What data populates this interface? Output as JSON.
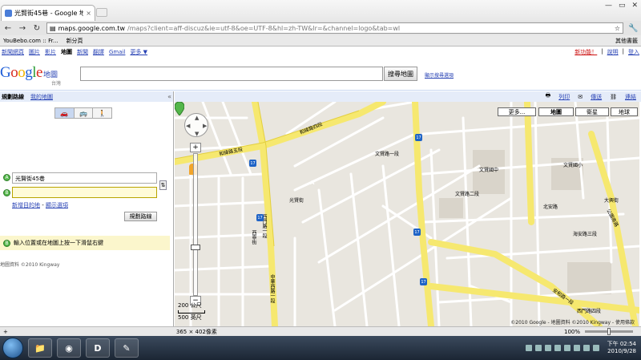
{
  "browser": {
    "tab_title": "光賢街45巷 - Google 地圖",
    "tab_close": "×",
    "url_domain": "maps.google.com.tw",
    "url_rest": "/maps?client=aff-discuz&ie=utf-8&oe=UTF-8&hl=zh-TW&lr=&channel=logo&tab=wl",
    "bookmarks": [
      "YouBebo.com :: Fr...",
      "新分頁"
    ],
    "other_bookmarks": "其他書籤"
  },
  "gbar": {
    "links": [
      "新聞網頁",
      "圖片",
      "影片",
      "地圖",
      "新聞",
      "翻譯",
      "Gmail",
      "更多 ▼"
    ],
    "current": "地圖",
    "new_feature": "新功能！",
    "help": "說明",
    "login": "登入"
  },
  "header": {
    "logo": "Google",
    "logo_suffix": "地圖",
    "region": "台灣",
    "search_value": "",
    "search_button": "搜尋地圖",
    "search_options": "顯示搜尋選項"
  },
  "panel": {
    "tab_directions": "規劃路線",
    "tab_mymaps": "我的地圖",
    "collapse": "«",
    "modes": [
      "🚗",
      "🚌",
      "🚶"
    ],
    "pin_a": "A",
    "pin_b": "B",
    "field_a": "光賢街45巷",
    "field_b": "",
    "swap": "⇅",
    "add_destination": "新增目的地",
    "separator": " - ",
    "show_options": "顯示選項",
    "route_button": "規劃路線",
    "hint": "輸入位置或在地圖上按一下滑鼠右鍵",
    "copyright": "地圖資料 ©2010 Kingway"
  },
  "maptools": {
    "print": "列印",
    "send": "傳送",
    "link": "連結"
  },
  "map": {
    "types": [
      "更多...",
      "地圖",
      "衛星",
      "地球"
    ],
    "active_type": "地圖",
    "scale_top": "200 公尺",
    "scale_bottom": "500 英尺",
    "copyright": "©2010 Google - 地圖資料 ©2010 Kingway - 使用條款",
    "marker_label": "A",
    "street_labels": [
      "和緯路四段",
      "和緯路五段",
      "西門路一段",
      "光賢街",
      "文賢路一段",
      "文賢國中",
      "文賢國小",
      "文賢路二段",
      "北安路",
      "公園南路",
      "西門路四段",
      "大興街",
      "中華西路一段",
      "西寧街",
      "安和路一段",
      "海安路三段"
    ],
    "route_badges": [
      "17",
      "17",
      "17",
      "17",
      "17",
      "17"
    ]
  },
  "statusbar": {
    "size": "365 × 402像素",
    "zoom": "100%"
  },
  "taskbar": {
    "apps": [
      "📁",
      "◉",
      "D",
      "✎"
    ],
    "time": "下午 02:54",
    "date": "2010/9/28"
  },
  "colors": {
    "road_main": "#f6e86f",
    "road_minor": "#ffffff",
    "map_bg": "#e9e6df",
    "block": "#d9d4ca",
    "pin_green": "#53b64a",
    "link_blue": "#2a44b5"
  }
}
